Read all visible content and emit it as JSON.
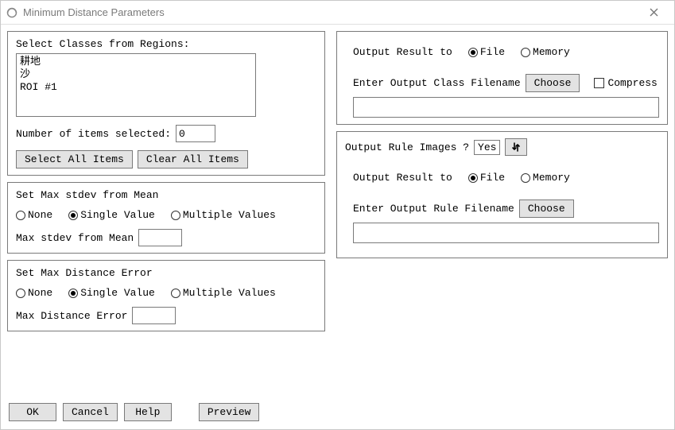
{
  "window": {
    "title": "Minimum Distance Parameters"
  },
  "left": {
    "select_label": "Select Classes from Regions:",
    "items": [
      "耕地",
      "沙",
      "ROI #1"
    ],
    "num_items_label": "Number of items selected:",
    "num_items_value": "0",
    "select_all": "Select All Items",
    "clear_all": "Clear All Items",
    "stdev_group": "Set Max stdev from Mean",
    "dist_group": "Set Max Distance Error",
    "radio_none": "None",
    "radio_single": "Single Value",
    "radio_multiple": "Multiple Values",
    "stdev_field": "Max stdev from Mean",
    "dist_field": "Max Distance Error"
  },
  "right": {
    "output1_label": "Output Result to",
    "radio_file": "File",
    "radio_memory": "Memory",
    "class_filename_label": "Enter Output Class Filename",
    "choose": "Choose",
    "compress": "Compress",
    "rule_q": "Output Rule Images ?",
    "rule_val": "Yes",
    "rule_filename_label": "Enter Output Rule Filename"
  },
  "footer": {
    "ok": "OK",
    "cancel": "Cancel",
    "help": "Help",
    "preview": "Preview"
  }
}
